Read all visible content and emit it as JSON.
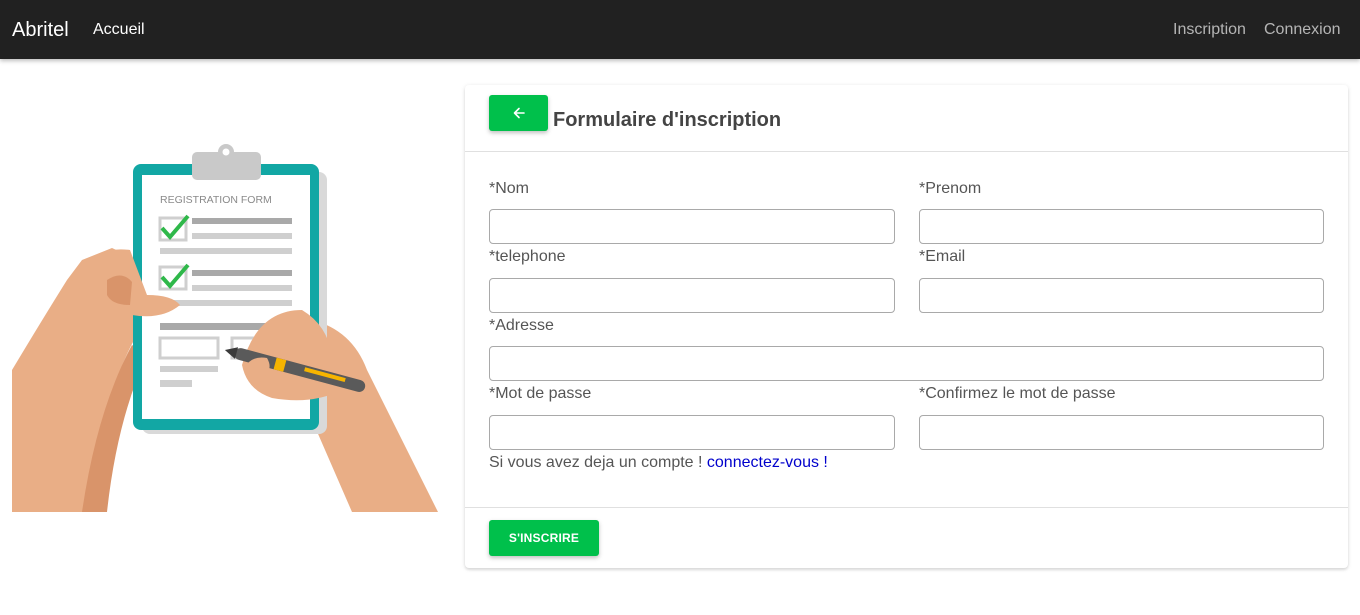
{
  "navbar": {
    "brand": "Abritel",
    "home": "Accueil",
    "register": "Inscription",
    "login": "Connexion"
  },
  "illustration": {
    "caption": "REGISTRATION FORM"
  },
  "form": {
    "back_icon": "arrow-left-icon",
    "title": "Formulaire d'inscription",
    "fields": {
      "nom": {
        "label": "*Nom",
        "value": ""
      },
      "prenom": {
        "label": "*Prenom",
        "value": ""
      },
      "telephone": {
        "label": "*telephone",
        "value": ""
      },
      "email": {
        "label": "*Email",
        "value": ""
      },
      "adresse": {
        "label": "*Adresse",
        "value": ""
      },
      "password": {
        "label": "*Mot de passe",
        "value": ""
      },
      "confirm_password": {
        "label": "*Confirmez le mot de passe",
        "value": ""
      }
    },
    "hint_text": "Si vous avez deja un compte !",
    "hint_link": "connectez-vous !",
    "submit_label": "S'INSCRIRE"
  },
  "colors": {
    "navbar_bg": "#212121",
    "accent_green": "#00c04b",
    "link_blue": "#0000cc",
    "clipboard_teal": "#12a7a4"
  }
}
